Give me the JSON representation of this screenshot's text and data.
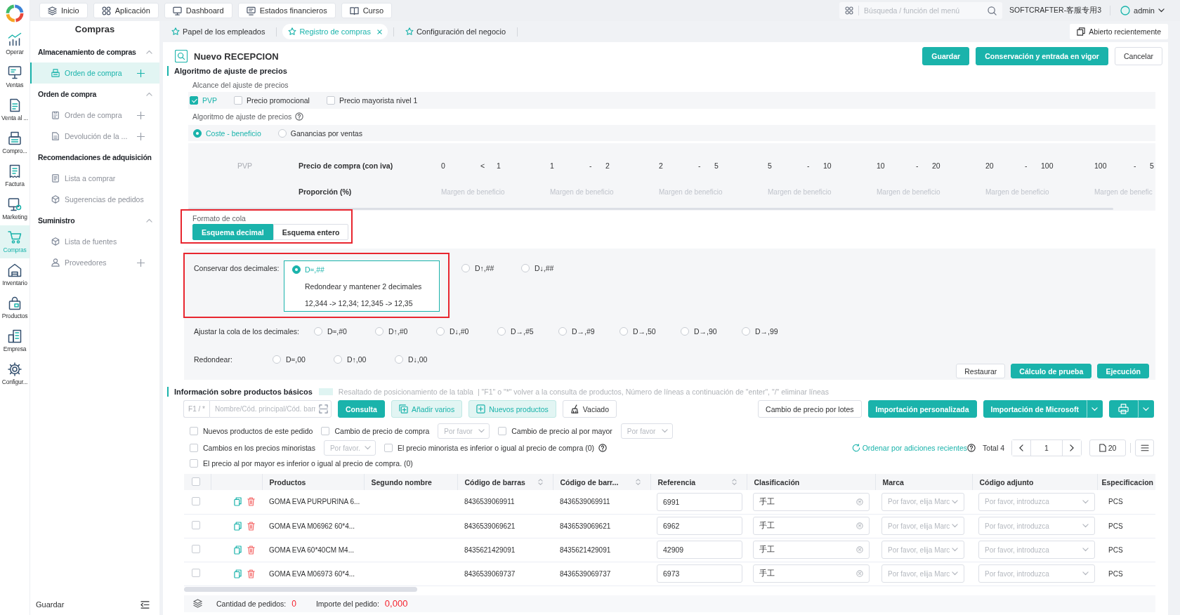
{
  "rail": {
    "items": [
      {
        "label": "Operar",
        "selected": false
      },
      {
        "label": "Ventas",
        "selected": false
      },
      {
        "label": "Venta al ...",
        "selected": false
      },
      {
        "label": "Compro...",
        "selected": false
      },
      {
        "label": "Factura",
        "selected": false
      },
      {
        "label": "Marketing",
        "selected": false
      },
      {
        "label": "Compras",
        "selected": true
      },
      {
        "label": "Inventario",
        "selected": false
      },
      {
        "label": "Productos",
        "selected": false
      },
      {
        "label": "Empresa",
        "selected": false
      },
      {
        "label": "Configur...",
        "selected": false
      }
    ]
  },
  "topbar": {
    "tabs": [
      {
        "label": "Inicio"
      },
      {
        "label": "Aplicación"
      },
      {
        "label": "Dashboard"
      },
      {
        "label": "Estados financieros"
      },
      {
        "label": "Curso"
      }
    ],
    "search": {
      "placeholder": "Búsqueda / función del menú"
    },
    "company": "SOFTCRAFTER-客服专用3",
    "user": "admin"
  },
  "sidebar": {
    "title": "Compras",
    "groups": [
      {
        "title": "Almacenamiento de compras",
        "kind": "collapsible",
        "expanded": true,
        "items": [
          {
            "label": "Orden de compra",
            "selected": true,
            "add": true
          }
        ]
      },
      {
        "title": "Orden de compra",
        "kind": "collapsible",
        "expanded": true,
        "items": [
          {
            "label": "Orden de compra",
            "selected": false,
            "add": true
          },
          {
            "label": "Devolución de la ...",
            "selected": false,
            "add": true
          }
        ]
      },
      {
        "title": "Recomendaciones de adquisición",
        "kind": "plain",
        "expanded": true,
        "items": [
          {
            "label": "Lista a comprar",
            "selected": false,
            "add": false
          },
          {
            "label": "Sugerencias de pedidos",
            "selected": false,
            "add": false
          }
        ]
      },
      {
        "title": "Suministro",
        "kind": "collapsible",
        "expanded": true,
        "items": [
          {
            "label": "Lista de fuentes",
            "selected": false,
            "add": false
          },
          {
            "label": "Proveedores",
            "selected": false,
            "add": true
          }
        ]
      }
    ],
    "footer": "Guardar"
  },
  "page_tabs": [
    {
      "label": "Papel de los empleados",
      "selected": false,
      "closable": false
    },
    {
      "label": "Registro de compras",
      "selected": true,
      "closable": true
    },
    {
      "label": "Configuración del negocio",
      "selected": false,
      "closable": false
    }
  ],
  "recent_button": "Abierto recientemente",
  "form": {
    "title": "Nuevo RECEPCION",
    "buttons": [
      {
        "label": "Guardar",
        "kind": "primary"
      },
      {
        "label": "Conservación y entrada en vigor",
        "kind": "primary"
      },
      {
        "label": "Cancelar",
        "kind": "default"
      }
    ]
  },
  "price_adjustment": {
    "title": "Algoritmo de ajuste de precios",
    "scope_label": "Alcance del ajuste de precios",
    "scope": [
      {
        "label": "PVP",
        "checked": true
      },
      {
        "label": "Precio promocional",
        "checked": false
      },
      {
        "label": "Precio mayorista nivel 1",
        "checked": false
      }
    ],
    "algorithm_label": "Algoritmo de ajuste de precios",
    "algorithms": [
      {
        "label": "Coste - beneficio",
        "selected": true
      },
      {
        "label": "Ganancias por ventas",
        "selected": false
      }
    ],
    "grid": {
      "row_label": "PVP",
      "price_label": "Precio de compra (con iva)",
      "ratio_label": "Proporción (%)",
      "ranges": [
        {
          "from": "0",
          "separator": "<",
          "to": "1",
          "placeholder": "Margen de beneficio"
        },
        {
          "from": "1",
          "separator": "-",
          "to": "2",
          "placeholder": "Margen de beneficio"
        },
        {
          "from": "2",
          "separator": "-",
          "to": "5",
          "placeholder": "Margen de beneficio"
        },
        {
          "from": "5",
          "separator": "-",
          "to": "10",
          "placeholder": "Margen de beneficio"
        },
        {
          "from": "10",
          "separator": "-",
          "to": "20",
          "placeholder": "Margen de beneficio"
        },
        {
          "from": "20",
          "separator": "-",
          "to": "100",
          "placeholder": "Margen de beneficio"
        },
        {
          "from": "100",
          "separator": "-",
          "to": "5",
          "placeholder": "Margen de benefic"
        }
      ]
    },
    "tail_format": {
      "label": "Formato de cola",
      "highlighted": true,
      "options": [
        {
          "label": "Esquema decimal",
          "selected": true
        },
        {
          "label": "Esquema entero",
          "selected": false
        }
      ]
    },
    "keep_two_decimals": {
      "label": "Conservar dos decimales:",
      "highlighted": true,
      "options": [
        {
          "label": "D≈,##",
          "selected": true,
          "description": "Redondear y mantener 2 decimales",
          "example": "12,344 -> 12,34; 12,345 -> 12,35"
        },
        {
          "label": "D↑,##",
          "selected": false
        },
        {
          "label": "D↓,##",
          "selected": false
        }
      ]
    },
    "adjust_tail": {
      "label": "Ajustar la cola de los decimales:",
      "options": [
        {
          "label": "D≈,#0",
          "selected": false
        },
        {
          "label": "D↑,#0",
          "selected": false
        },
        {
          "label": "D↓,#0",
          "selected": false
        },
        {
          "label": "D→,#5",
          "selected": false
        },
        {
          "label": "D→,#9",
          "selected": false
        },
        {
          "label": "D→,50",
          "selected": false
        },
        {
          "label": "D→,90",
          "selected": false
        },
        {
          "label": "D→,99",
          "selected": false
        }
      ]
    },
    "round": {
      "label": "Redondear:",
      "options": [
        {
          "label": "D≈,00",
          "selected": false
        },
        {
          "label": "D↑,00",
          "selected": false
        },
        {
          "label": "D↓,00",
          "selected": false
        }
      ]
    },
    "actions": [
      {
        "label": "Restaurar",
        "kind": "default"
      },
      {
        "label": "Cálculo de prueba",
        "kind": "primary"
      },
      {
        "label": "Ejecución",
        "kind": "primary"
      }
    ]
  },
  "products": {
    "title": "Información sobre productos básicos",
    "legend": "Resaltado de posicionamiento de la tabla",
    "hint": "| \"F1\" o \"*\" volver a la consulta de productos, Número de líneas a continuación de \"enter\", \"/\" eliminar líneas",
    "search": {
      "prefix": "F1 / *",
      "placeholder": "Nombre/Cód. principal/Cód. barr"
    },
    "left_buttons": [
      {
        "label": "Consulta",
        "kind": "primary"
      },
      {
        "label": "Añadir varios",
        "kind": "light"
      },
      {
        "label": "Nuevos productos",
        "kind": "light"
      },
      {
        "label": "Vaciado",
        "kind": "default"
      }
    ],
    "right_buttons": [
      {
        "label": "Cambio de precio por lotes",
        "kind": "default"
      },
      {
        "label": "Importación personalizada",
        "kind": "primary"
      },
      {
        "label": "Importación de Microsoft",
        "kind": "split"
      }
    ],
    "filter_rows": [
      {
        "controls": [
          {
            "kind": "checkbox",
            "label": "Nuevos productos de este pedido",
            "checked": false
          },
          {
            "kind": "checkbox",
            "label": "Cambio de precio de compra",
            "checked": false
          },
          {
            "kind": "select",
            "placeholder": "Por favor"
          },
          {
            "kind": "checkbox",
            "label": "Cambio de precio al por mayor",
            "checked": false
          },
          {
            "kind": "select",
            "placeholder": "Por favor"
          }
        ]
      },
      {
        "controls": [
          {
            "kind": "checkbox",
            "label": "Cambios en los precios minoristas",
            "checked": false
          },
          {
            "kind": "select",
            "placeholder": "Por favor."
          },
          {
            "kind": "checkbox",
            "label": "El precio minorista es inferior o igual al precio de compra (0)",
            "checked": false
          },
          {
            "kind": "help"
          }
        ],
        "pagination": {
          "sort_link": "Ordenar por adiciones recientes",
          "total": "Total 4",
          "page": "1",
          "page_size": "20"
        }
      },
      {
        "controls": [
          {
            "kind": "checkbox",
            "label": "El precio al por mayor es inferior o igual al precio de compra. (0)",
            "checked": false
          }
        ]
      }
    ],
    "table": {
      "select_all": {
        "checked": false
      },
      "columns": [
        {
          "label": "Productos",
          "sortable": false
        },
        {
          "label": "Segundo nombre",
          "sortable": false
        },
        {
          "label": "Código de barras",
          "sortable": true
        },
        {
          "label": "Código de barr...",
          "sortable": true
        },
        {
          "label": "Referencia",
          "sortable": true
        },
        {
          "label": "Clasificación",
          "sortable": false
        },
        {
          "label": "Marca",
          "sortable": false
        },
        {
          "label": "Código adjunto",
          "sortable": false
        },
        {
          "label": "Especificacion",
          "sortable": false
        }
      ],
      "rows": [
        {
          "checked": false,
          "product": "GOMA EVA PURPURINA 6...",
          "barcode": "8436539069911",
          "barcode_2": "8436539069911",
          "reference": "6991",
          "classification": "手工",
          "brand": {
            "placeholder": "Por favor, elija Marc"
          },
          "attached_code": {
            "placeholder": "Por favor, introduzca"
          },
          "spec": "PCS"
        },
        {
          "checked": false,
          "product": "GOMA EVA M06962 60*4...",
          "barcode": "8436539069621",
          "barcode_2": "8436539069621",
          "reference": "6962",
          "classification": "手工",
          "brand": {
            "placeholder": "Por favor, elija Marc"
          },
          "attached_code": {
            "placeholder": "Por favor, introduzca"
          },
          "spec": "PCS"
        },
        {
          "checked": false,
          "product": "GOMA EVA 60*40CM M4...",
          "barcode": "8435621429091",
          "barcode_2": "8435621429091",
          "reference": "42909",
          "classification": "手工",
          "brand": {
            "placeholder": "Por favor, elija Marc"
          },
          "attached_code": {
            "placeholder": "Por favor, introduzca"
          },
          "spec": "PCS"
        },
        {
          "checked": false,
          "product": "GOMA EVA M06973 60*4...",
          "barcode": "8436539069737",
          "barcode_2": "8436539069737",
          "reference": "6973",
          "classification": "手工",
          "brand": {
            "placeholder": "Por favor, elija Marc"
          },
          "attached_code": {
            "placeholder": "Por favor, introduzca"
          },
          "spec": "PCS"
        }
      ]
    },
    "summary": [
      {
        "label": "Cantidad de pedidos:",
        "value": "0"
      },
      {
        "label": "Importe del pedido:",
        "value": "0,000"
      }
    ]
  }
}
